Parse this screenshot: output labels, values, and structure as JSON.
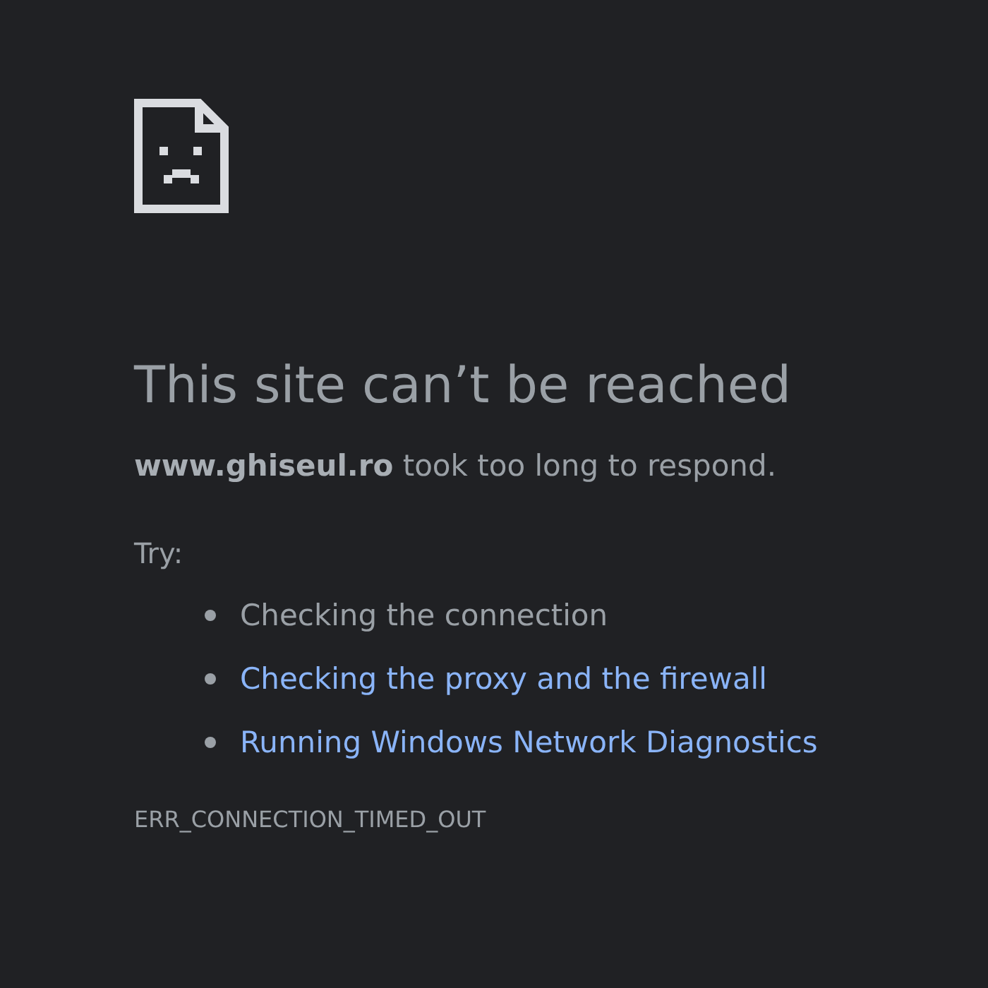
{
  "title": "This site can’t be reached",
  "message": "**www.ghiseul.ro** took too long to respond.",
  "try_label": "Try:",
  "suggestions": [
    {
      "text": "Checking the connection",
      "kind": "plain"
    },
    {
      "text": "Checking the proxy and the firewall",
      "kind": "link"
    },
    {
      "text": "Running Windows Network Diagnostics",
      "kind": "link"
    }
  ],
  "error_code": "ERR_CONNECTION_TIMED_OUT"
}
